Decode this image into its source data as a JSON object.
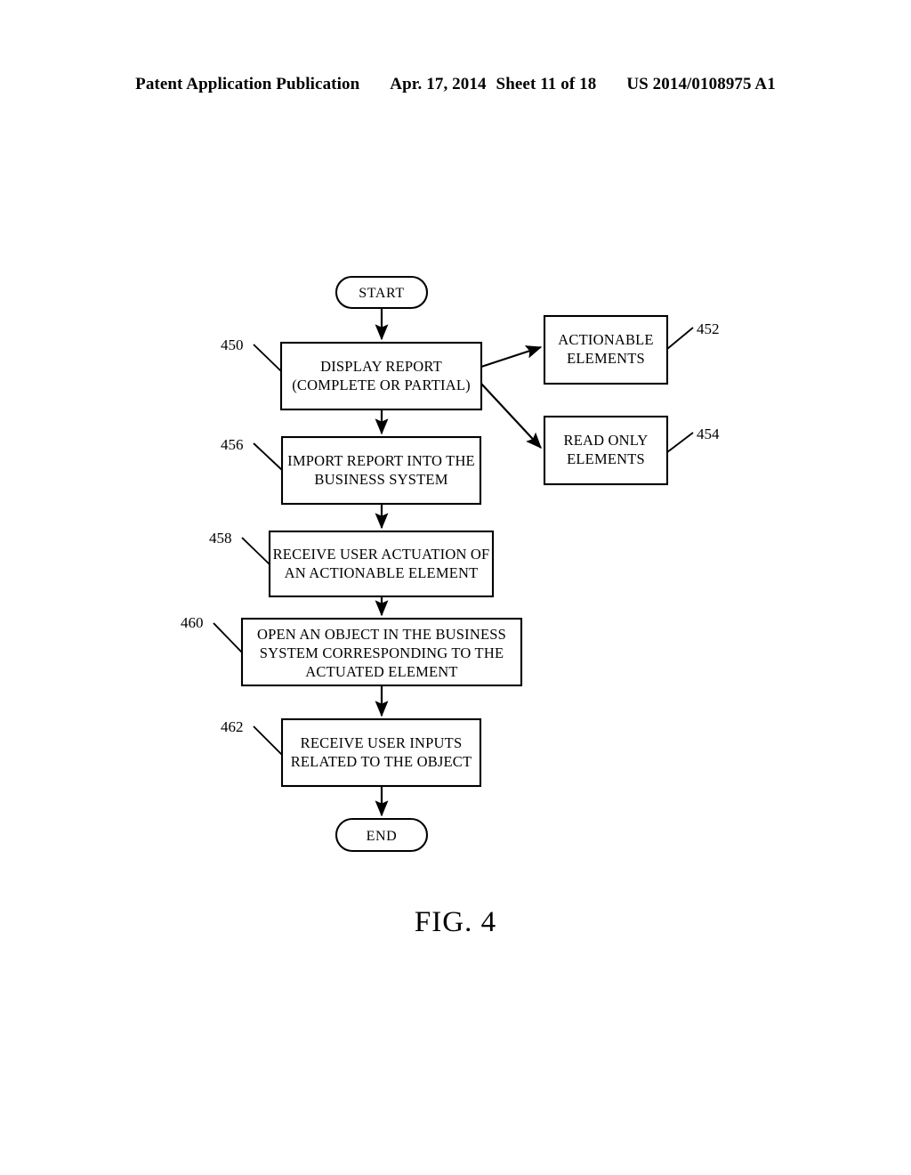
{
  "header": {
    "publication": "Patent Application Publication",
    "date": "Apr. 17, 2014",
    "sheet": "Sheet 11 of 18",
    "doc_number": "US 2014/0108975 A1"
  },
  "figure": {
    "caption": "FIG. 4",
    "type": "flowchart"
  },
  "nodes": {
    "start": {
      "label": "START",
      "shape": "terminator"
    },
    "display_report": {
      "line1": "DISPLAY REPORT",
      "line2": "(COMPLETE OR PARTIAL)",
      "ref": "450",
      "shape": "process"
    },
    "actionable_elements": {
      "line1": "ACTIONABLE",
      "line2": "ELEMENTS",
      "ref": "452",
      "shape": "process"
    },
    "read_only_elements": {
      "line1": "READ ONLY",
      "line2": "ELEMENTS",
      "ref": "454",
      "shape": "process"
    },
    "import_report": {
      "line1": "IMPORT REPORT INTO THE",
      "line2": "BUSINESS SYSTEM",
      "ref": "456",
      "shape": "process"
    },
    "receive_actuation": {
      "line1": "RECEIVE USER ACTUATION OF",
      "line2": "AN ACTIONABLE ELEMENT",
      "ref": "458",
      "shape": "process"
    },
    "open_object": {
      "line1": "OPEN AN OBJECT IN THE BUSINESS",
      "line2": "SYSTEM CORRESPONDING TO THE",
      "line3": "ACTUATED ELEMENT",
      "ref": "460",
      "shape": "process"
    },
    "receive_inputs": {
      "line1": "RECEIVE USER INPUTS",
      "line2": "RELATED TO THE OBJECT",
      "ref": "462",
      "shape": "process"
    },
    "end": {
      "label": "END",
      "shape": "terminator"
    }
  },
  "colors": {
    "ink": "#000000",
    "paper": "#ffffff"
  }
}
